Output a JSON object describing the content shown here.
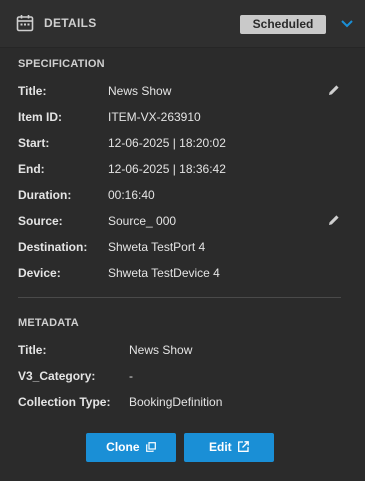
{
  "header": {
    "title": "DETAILS",
    "status": "Scheduled",
    "icon": "calendar-icon",
    "accent_color": "#1a8fd6"
  },
  "specification": {
    "title": "SPECIFICATION",
    "rows": [
      {
        "label": "Title:",
        "value": "News Show",
        "editable": true
      },
      {
        "label": "Item ID:",
        "value": "ITEM-VX-263910"
      },
      {
        "label": "Start:",
        "value": "12-06-2025 | 18:20:02"
      },
      {
        "label": "End:",
        "value": "12-06-2025 | 18:36:42"
      },
      {
        "label": "Duration:",
        "value": "00:16:40"
      },
      {
        "label": "Source:",
        "value": "Source_ 000",
        "editable": true
      },
      {
        "label": "Destination:",
        "value": "Shweta TestPort 4"
      },
      {
        "label": "Device:",
        "value": "Shweta TestDevice 4"
      }
    ]
  },
  "metadata": {
    "title": "METADATA",
    "rows": [
      {
        "label": "Title:",
        "value": "News Show"
      },
      {
        "label": "V3_Category:",
        "value": "-"
      },
      {
        "label": "Collection Type:",
        "value": "BookingDefinition"
      }
    ]
  },
  "actions": {
    "clone_label": "Clone",
    "edit_label": "Edit"
  }
}
